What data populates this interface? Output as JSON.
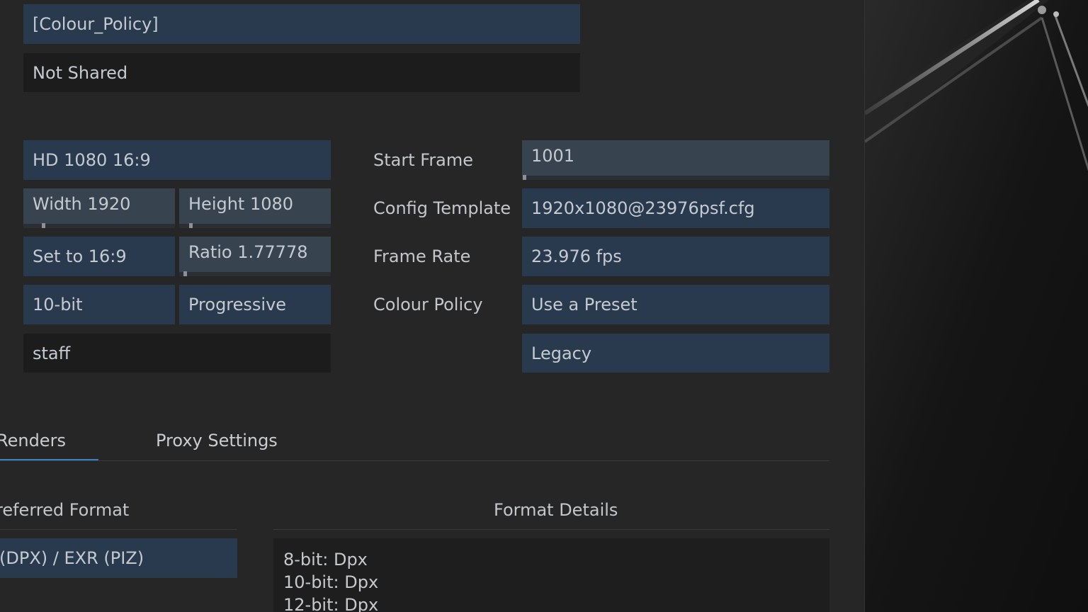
{
  "policy": {
    "colour_policy_title": "[Colour_Policy]",
    "sharing": "Not Shared"
  },
  "format": {
    "preset": "HD 1080 16:9",
    "width_label": "Width 1920",
    "height_label": "Height 1080",
    "set_aspect_label": "Set to 16:9",
    "ratio_label": "Ratio 1.77778",
    "bit_depth": "10-bit",
    "scan": "Progressive",
    "group": "staff"
  },
  "settings": {
    "start_frame_label": "Start Frame",
    "start_frame_value": "1001",
    "config_template_label": "Config Template",
    "config_template_value": "1920x1080@23976psf.cfg",
    "frame_rate_label": "Frame Rate",
    "frame_rate_value": "23.976 fps",
    "colour_policy_label": "Colour Policy",
    "colour_policy_value": "Use a Preset",
    "colour_preset_value": "Legacy"
  },
  "tabs": [
    {
      "label": "Renders",
      "active": true
    },
    {
      "label": "Proxy Settings",
      "active": false
    }
  ],
  "renders": {
    "preferred_format_label": "referred Format",
    "preferred_format_value": "(DPX) / EXR (PIZ)",
    "format_details_label": "Format Details",
    "format_details_lines": [
      "8-bit: Dpx",
      "10-bit: Dpx",
      "12-bit: Dpx"
    ]
  },
  "colors": {
    "accent": "#3d7fc4",
    "field_blue": "#2a3a4e",
    "field_slate": "#37444f",
    "field_dark": "#1c1c1c"
  }
}
